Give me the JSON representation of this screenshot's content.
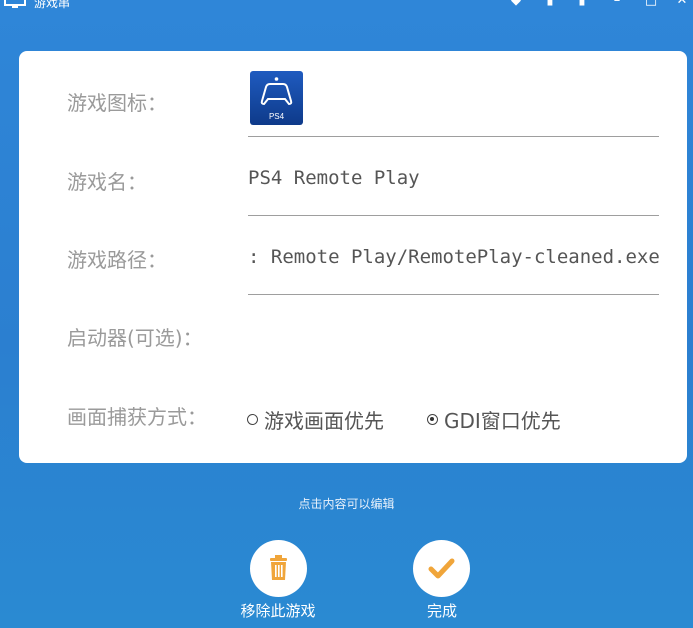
{
  "window": {
    "title": "游戏串"
  },
  "form": {
    "icon_label": "游戏图标：",
    "icon_badge": "PS4",
    "name_label": "游戏名：",
    "name_value": "PS4 Remote Play",
    "path_label": "游戏路径：",
    "path_value": ": Remote Play/RemotePlay-cleaned.exe",
    "launcher_label": "启动器(可选)：",
    "capture_label": "画面捕获方式：",
    "capture_options": [
      {
        "label": "游戏画面优先",
        "selected": false
      },
      {
        "label": "GDI窗口优先",
        "selected": true
      }
    ]
  },
  "hint": "点击内容可以编辑",
  "actions": {
    "remove_label": "移除此游戏",
    "done_label": "完成"
  },
  "colors": {
    "background": "#2b7fd0",
    "trash": "#f0a53a",
    "check": "#f0a53a"
  }
}
